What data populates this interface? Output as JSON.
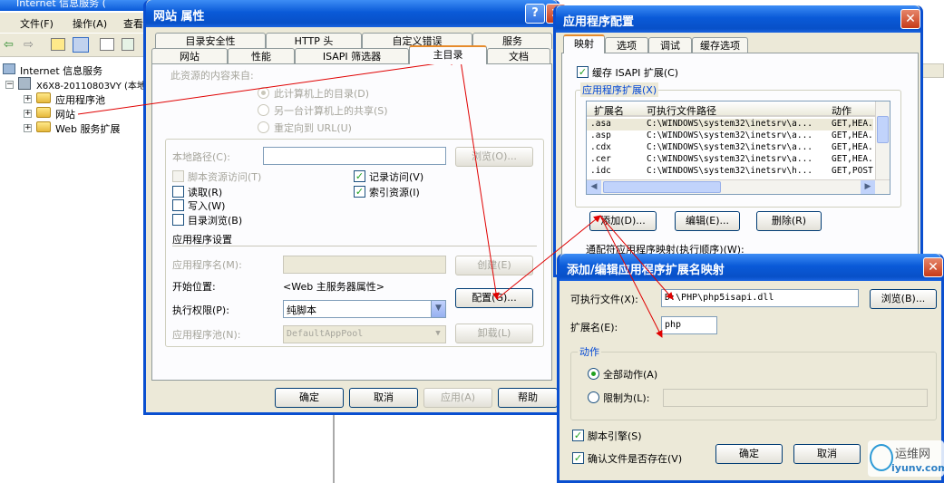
{
  "background_app": {
    "title": "Internet 信息服务 (",
    "menu": [
      "文件(F)",
      "操作(A)",
      "查看"
    ],
    "tree": {
      "root": "Internet 信息服务",
      "computer": "X6X8-20110803VY (本地",
      "items": [
        "应用程序池",
        "网站",
        "Web 服务扩展"
      ]
    }
  },
  "site_props": {
    "title": "网站 属性",
    "tabs_row1": [
      "目录安全性",
      "HTTP 头",
      "自定义错误",
      "服务"
    ],
    "tabs_row2": [
      "网站",
      "性能",
      "ISAPI 筛选器",
      "主目录",
      "文档"
    ],
    "source_label": "此资源的内容来自:",
    "source_options": [
      "此计算机上的目录(D)",
      "另一台计算机上的共享(S)",
      "重定向到 URL(U)"
    ],
    "local_path_label": "本地路径(C):",
    "browse": "浏览(O)...",
    "checks": {
      "script_access": "脚本资源访问(T)",
      "log_visits": "记录访问(V)",
      "read": "读取(R)",
      "index": "索引资源(I)",
      "write": "写入(W)",
      "dir_browse": "目录浏览(B)"
    },
    "app_settings": "应用程序设置",
    "app_name_label": "应用程序名(M):",
    "create_btn": "创建(E)",
    "start_point_label": "开始位置:",
    "start_point_value": "<Web 主服务器属性>",
    "exec_perm_label": "执行权限(P):",
    "exec_perm_value": "纯脚本",
    "config_btn": "配置(G)...",
    "app_pool_label": "应用程序池(N):",
    "app_pool_value": "DefaultAppPool",
    "unload_btn": "卸载(L)",
    "ok": "确定",
    "cancel": "取消",
    "apply": "应用(A)",
    "help": "帮助"
  },
  "app_config": {
    "title": "应用程序配置",
    "tabs": [
      "映射",
      "选项",
      "调试",
      "缓存选项"
    ],
    "cache_isapi": "缓存 ISAPI 扩展(C)",
    "extensions_label": "应用程序扩展(X)",
    "columns": [
      "扩展名",
      "可执行文件路径",
      "动作"
    ],
    "rows": [
      {
        "ext": ".asa",
        "path": "C:\\WINDOWS\\system32\\inetsrv\\a...",
        "verbs": "GET,HEA."
      },
      {
        "ext": ".asp",
        "path": "C:\\WINDOWS\\system32\\inetsrv\\a...",
        "verbs": "GET,HEA."
      },
      {
        "ext": ".cdx",
        "path": "C:\\WINDOWS\\system32\\inetsrv\\a...",
        "verbs": "GET,HEA."
      },
      {
        "ext": ".cer",
        "path": "C:\\WINDOWS\\system32\\inetsrv\\a...",
        "verbs": "GET,HEA."
      },
      {
        "ext": ".idc",
        "path": "C:\\WINDOWS\\system32\\inetsrv\\h...",
        "verbs": "GET,POST"
      }
    ],
    "add_btn": "添加(D)...",
    "edit_btn": "编辑(E)...",
    "remove_btn": "删除(R)",
    "wildcard_label": "通配符应用程序映射(执行顺序)(W):"
  },
  "ext_mapping": {
    "title": "添加/编辑应用程序扩展名映射",
    "exe_label": "可执行文件(X):",
    "exe_value": "D:\\PHP\\php5isapi.dll",
    "browse_btn": "浏览(B)...",
    "ext_label": "扩展名(E):",
    "ext_value": "php",
    "verbs_group": "动作",
    "all_verbs": "全部动作(A)",
    "limit_to": "限制为(L):",
    "script_engine": "脚本引擎(S)",
    "verify_file": "确认文件是否存在(V)",
    "ok": "确定",
    "cancel": "取消"
  },
  "watermark": {
    "line1": "运维网",
    "line2": "iyunv.com"
  }
}
